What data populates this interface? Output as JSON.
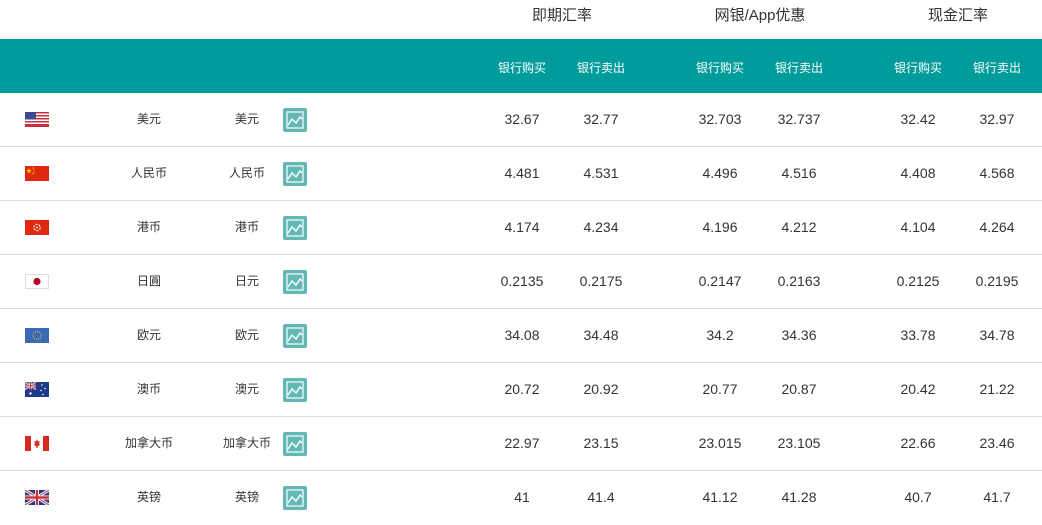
{
  "header": {
    "groups": [
      "即期汇率",
      "网银/App优惠",
      "现金汇率"
    ],
    "sub_labels": [
      "银行购买",
      "银行卖出",
      "银行购买",
      "银行卖出",
      "银行购买",
      "银行卖出"
    ]
  },
  "rows": [
    {
      "flag": "us-flag-icon",
      "name": "美元",
      "alt_name": "美元",
      "values": [
        "32.67",
        "32.77",
        "32.703",
        "32.737",
        "32.42",
        "32.97"
      ]
    },
    {
      "flag": "china-flag-icon",
      "name": "人民币",
      "alt_name": "人民币",
      "values": [
        "4.481",
        "4.531",
        "4.496",
        "4.516",
        "4.408",
        "4.568"
      ]
    },
    {
      "flag": "hong-kong-flag-icon",
      "name": "港币",
      "alt_name": "港币",
      "values": [
        "4.174",
        "4.234",
        "4.196",
        "4.212",
        "4.104",
        "4.264"
      ]
    },
    {
      "flag": "japan-flag-icon",
      "name": "日圓",
      "alt_name": "日元",
      "values": [
        "0.2135",
        "0.2175",
        "0.2147",
        "0.2163",
        "0.2125",
        "0.2195"
      ]
    },
    {
      "flag": "eu-flag-icon",
      "name": "欧元",
      "alt_name": "欧元",
      "values": [
        "34.08",
        "34.48",
        "34.2",
        "34.36",
        "33.78",
        "34.78"
      ]
    },
    {
      "flag": "australia-flag-icon",
      "name": "澳币",
      "alt_name": "澳元",
      "values": [
        "20.72",
        "20.92",
        "20.77",
        "20.87",
        "20.42",
        "21.22"
      ]
    },
    {
      "flag": "canada-flag-icon",
      "name": "加拿大币",
      "alt_name": "加拿大币",
      "values": [
        "22.97",
        "23.15",
        "23.015",
        "23.105",
        "22.66",
        "23.46"
      ]
    },
    {
      "flag": "uk-flag-icon",
      "name": "英镑",
      "alt_name": "英镑",
      "values": [
        "41",
        "41.4",
        "41.12",
        "41.28",
        "40.7",
        "41.7"
      ]
    }
  ],
  "colors": {
    "header_bar": "#009b9b",
    "chart_button": "#62b8b5",
    "row_divider": "#d9d9d9"
  }
}
